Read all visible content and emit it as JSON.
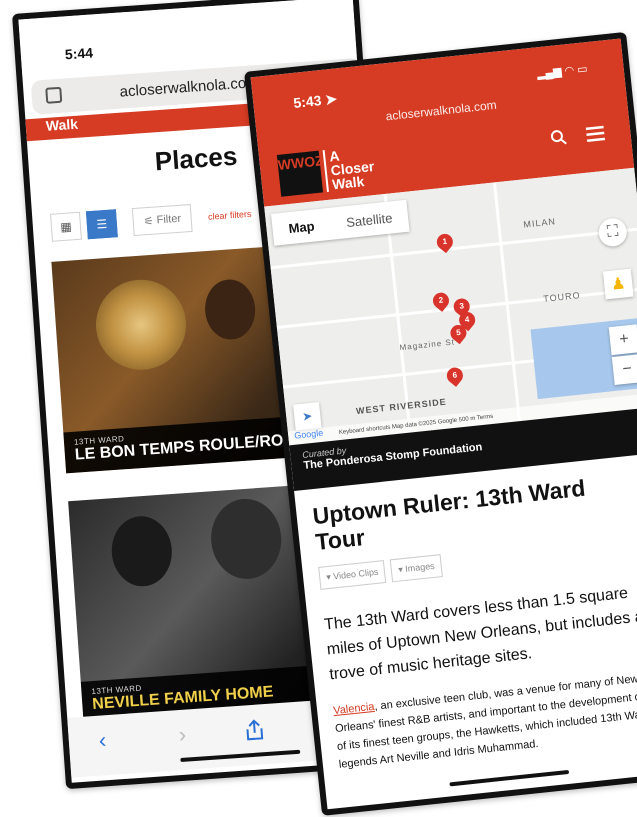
{
  "back_phone": {
    "status_time": "5:44",
    "url": "acloserwalknola.co",
    "logo_text": "Walk",
    "page_title": "Places",
    "toolbar": {
      "filter_label": "Filter",
      "clear_label": "clear filters"
    },
    "cards": [
      {
        "ward": "13TH WARD",
        "title": "LE BON TEMPS ROULE/RO RESIDENCE"
      },
      {
        "ward": "13TH WARD",
        "title": "NEVILLE FAMILY HOME"
      }
    ],
    "nav": {
      "back": "‹",
      "forward": "›"
    }
  },
  "front_phone": {
    "status_time": "5:43",
    "url": "acloserwalknola.com",
    "logo": {
      "mark": "WWOZ",
      "brand_line1": "A",
      "brand_line2": "Closer",
      "brand_line3": "Walk"
    },
    "map": {
      "toggle_map": "Map",
      "toggle_satellite": "Satellite",
      "labels": [
        "MILAN",
        "TOURO",
        "WEST RIVERSIDE",
        "Magazine St"
      ],
      "pins": [
        "1",
        "2",
        "3",
        "4",
        "5",
        "6"
      ],
      "attribution": "Keyboard shortcuts   Map data ©2025 Google   500 m   Terms",
      "google": "Google"
    },
    "curated_label": "Curated by",
    "curator": "The Ponderosa Stomp Foundation",
    "tour_title": "Uptown Ruler: 13th Ward Tour",
    "pills": [
      "▾ Video Clips",
      "▾ Images"
    ],
    "intro": "The 13th Ward covers less than 1.5 square miles of Uptown New Orleans, but includes a trove of music heritage sites.",
    "body_link": "Valencia",
    "body_rest": ", an exclusive teen club, was a venue for many of New Orleans' finest R&B artists, and important to the development of one of its finest teen groups, the Hawketts, which included 13th Ward legends Art Neville and Idris Muhammad."
  },
  "colors": {
    "brand_red": "#d63b23",
    "link_blue": "#2a6fd6",
    "caption_yellow": "#f0d04a"
  }
}
